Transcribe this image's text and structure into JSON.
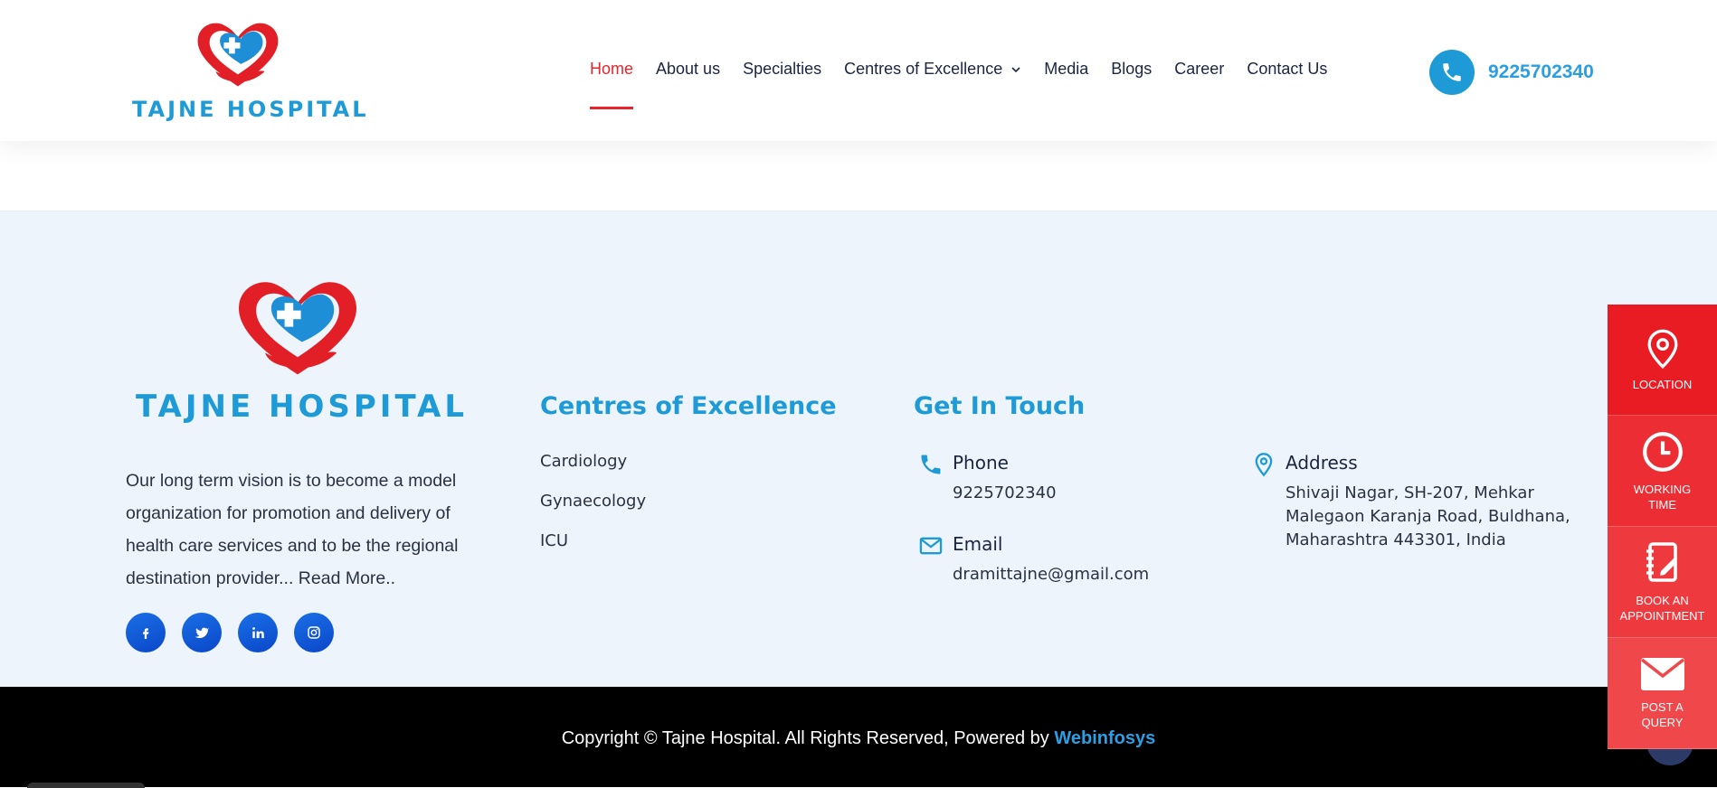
{
  "header": {
    "logo_text": "TAJNE HOSPITAL",
    "nav": [
      {
        "label": "Home"
      },
      {
        "label": "About us"
      },
      {
        "label": "Specialties"
      },
      {
        "label": "Centres of Excellence"
      },
      {
        "label": "Media"
      },
      {
        "label": "Blogs"
      },
      {
        "label": "Career"
      },
      {
        "label": "Contact Us"
      }
    ],
    "phone": "9225702340"
  },
  "footer": {
    "logo_text": "TAJNE HOSPITAL",
    "about_text": "Our long term vision is to become a model organization for promotion and delivery of health care services and to be the regional destination provider...",
    "read_more": "Read More..",
    "socials": [
      "facebook-icon",
      "twitter-icon",
      "linkedin-icon",
      "instagram-icon"
    ],
    "coe": {
      "title": "Centres of Excellence",
      "items": [
        "Cardiology",
        "Gynaecology",
        "ICU"
      ]
    },
    "get_in_touch": {
      "title": "Get In Touch",
      "phone_label": "Phone",
      "phone": "9225702340",
      "email_label": "Email",
      "email": "dramittajne@gmail.com",
      "address_label": "Address",
      "address": "Shivaji Nagar, SH-207, Mehkar Malegaon Karanja Road, Buldhana, Maharashtra 443301, India"
    }
  },
  "copyright": {
    "text": "Copyright © Tajne Hospital. All Rights Reserved, Powered by",
    "brand": "Webinfosys"
  },
  "side_actions": [
    {
      "label": "LOCATION"
    },
    {
      "label": "WORKING\nTIME"
    },
    {
      "label": "BOOK AN\nAPPOINTMENT"
    },
    {
      "label": "POST A\nQUERY"
    }
  ],
  "colors": {
    "brand_blue": "#1e9bd7",
    "accent_red": "#e8252c",
    "footer_bg": "#eef4fb",
    "copyright_bg": "#000000"
  }
}
